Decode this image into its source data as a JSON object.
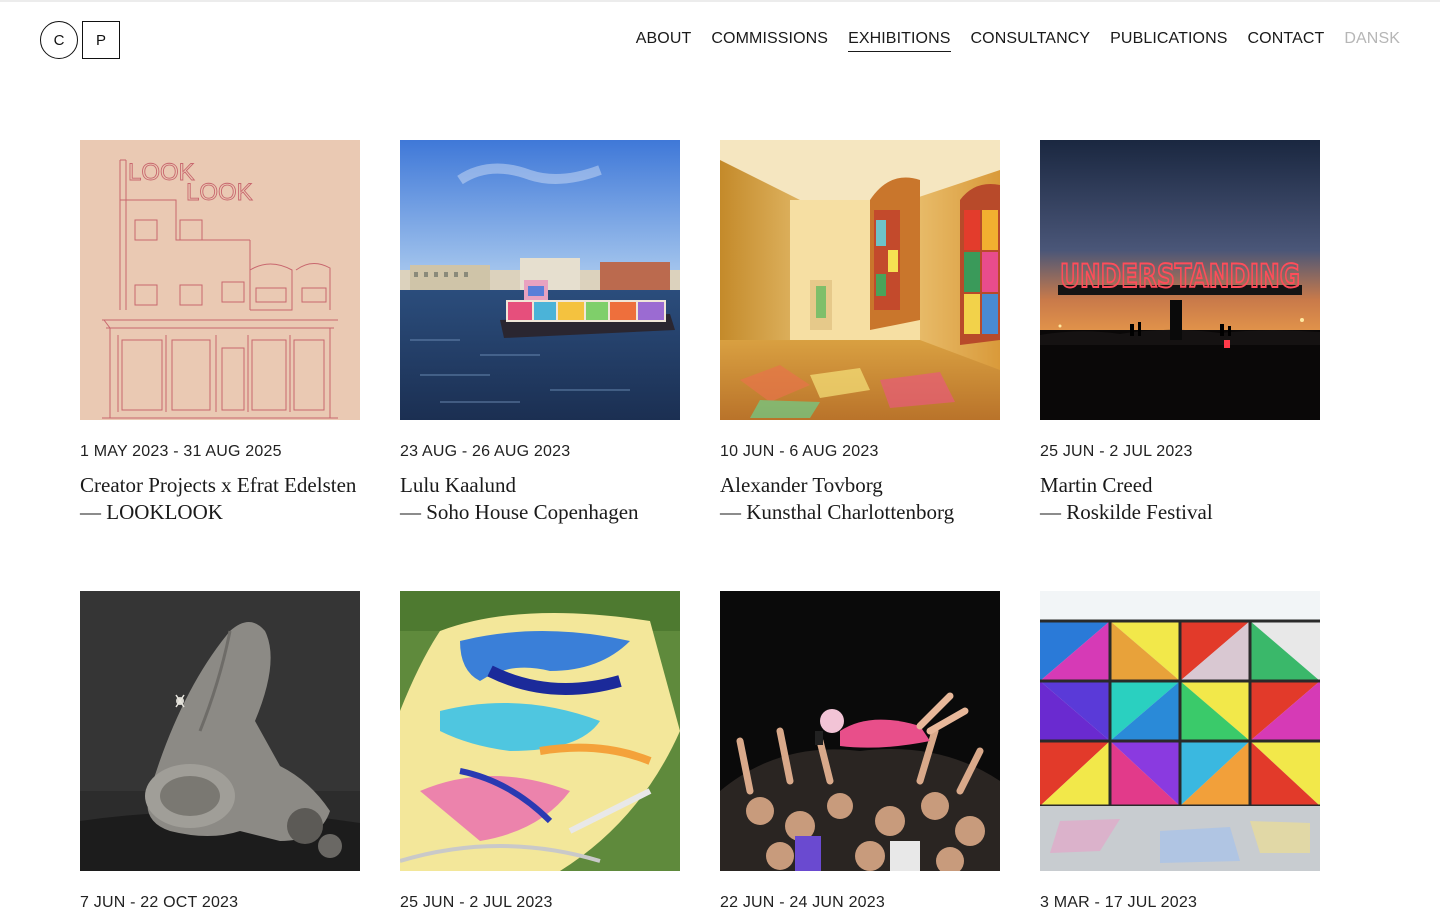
{
  "header": {
    "logo_left": "C",
    "logo_right": "P",
    "nav": [
      {
        "label": "ABOUT"
      },
      {
        "label": "COMMISSIONS"
      },
      {
        "label": "EXHIBITIONS",
        "active": true
      },
      {
        "label": "CONSULTANCY"
      },
      {
        "label": "PUBLICATIONS"
      },
      {
        "label": "CONTACT"
      },
      {
        "label": "DANSK",
        "muted": true
      }
    ]
  },
  "exhibitions": [
    {
      "date": "1 MAY 2023 - 31 AUG 2025",
      "title": "Creator Projects x Efrat Edelsten",
      "subtitle": "— LOOKLOOK",
      "image_text": "LOOK LOOK",
      "image": "line-drawing-building"
    },
    {
      "date": "23 AUG - 26 AUG 2023",
      "title": "Lulu Kaalund",
      "subtitle": "— Soho House Copenhagen",
      "image": "painted-boat-harbour"
    },
    {
      "date": "10 JUN - 6 AUG 2023",
      "title": "Alexander Tovborg",
      "subtitle": "— Kunsthal Charlottenborg",
      "image": "stained-glass-hall"
    },
    {
      "date": "25 JUN - 2 JUL 2023",
      "title": "Martin Creed",
      "subtitle": "— Roskilde Festival",
      "image_text": "UNDERSTANDING",
      "image": "neon-sign-sunset"
    },
    {
      "date": "7 JUN - 22 OCT 2023",
      "title": "",
      "subtitle": "",
      "image": "stone-sculpture"
    },
    {
      "date": "25 JUN - 2 JUL 2023",
      "title": "",
      "subtitle": "",
      "image": "painted-ground-artwork"
    },
    {
      "date": "22 JUN - 24 JUN 2023",
      "title": "",
      "subtitle": "",
      "image": "crowd-surfing-concert"
    },
    {
      "date": "3 MAR - 17 JUL 2023",
      "title": "",
      "subtitle": "",
      "image": "colored-glass-window"
    }
  ]
}
